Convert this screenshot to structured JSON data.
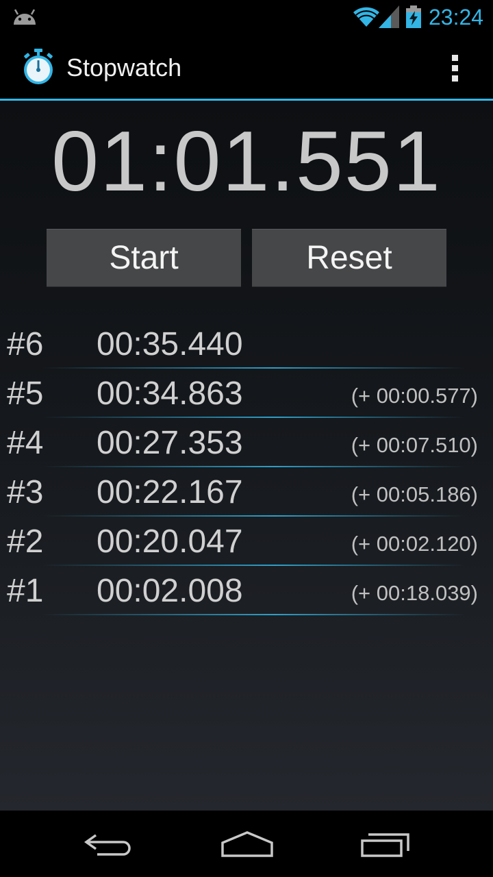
{
  "status_bar": {
    "time": "23:24",
    "icons": [
      "android-icon",
      "wifi-icon",
      "signal-icon",
      "battery-charging-icon"
    ]
  },
  "action_bar": {
    "title": "Stopwatch",
    "icons": [
      "stopwatch-icon",
      "overflow-menu-icon"
    ]
  },
  "timer": {
    "elapsed": "01:01.551"
  },
  "buttons": {
    "start_label": "Start",
    "reset_label": "Reset"
  },
  "laps": [
    {
      "num": "#6",
      "time": "00:35.440",
      "diff": ""
    },
    {
      "num": "#5",
      "time": "00:34.863",
      "diff": "(+ 00:00.577)"
    },
    {
      "num": "#4",
      "time": "00:27.353",
      "diff": "(+ 00:07.510)"
    },
    {
      "num": "#3",
      "time": "00:22.167",
      "diff": "(+ 00:05.186)"
    },
    {
      "num": "#2",
      "time": "00:20.047",
      "diff": "(+ 00:02.120)"
    },
    {
      "num": "#1",
      "time": "00:02.008",
      "diff": "(+ 00:18.039)"
    }
  ],
  "nav_bar": {
    "icons": [
      "back-icon",
      "home-icon",
      "recents-icon"
    ]
  },
  "colors": {
    "accent": "#33b5e5",
    "button": "#464749",
    "text": "#d0d0d0"
  }
}
